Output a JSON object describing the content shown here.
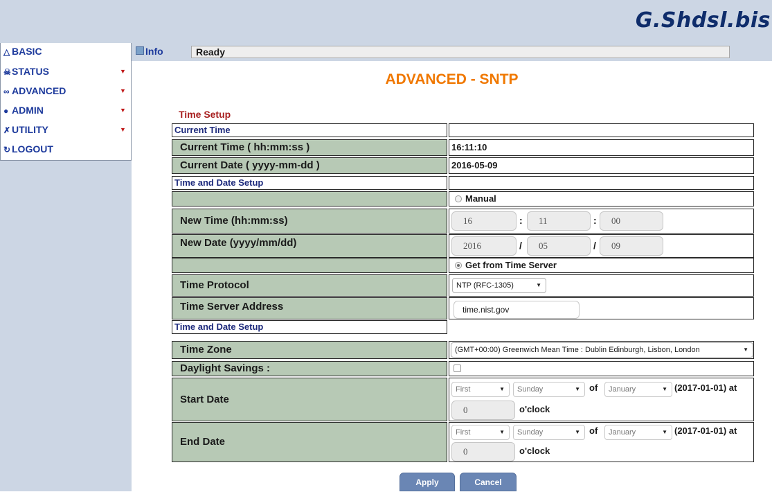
{
  "brand": {
    "name": "G.Shdsl.bis"
  },
  "menu": {
    "items": [
      {
        "label": "BASIC",
        "icon": "basic-icon"
      },
      {
        "label": "STATUS",
        "icon": "status-icon"
      },
      {
        "label": "ADVANCED",
        "icon": "advanced-icon"
      },
      {
        "label": "ADMIN",
        "icon": "admin-icon"
      },
      {
        "label": "UTILITY",
        "icon": "utility-icon"
      },
      {
        "label": "LOGOUT",
        "icon": "logout-icon"
      }
    ]
  },
  "info": {
    "label": "Info",
    "status": "Ready"
  },
  "page": {
    "title": "ADVANCED - SNTP",
    "section": "Time Setup"
  },
  "table": {
    "current_time_header": "Current Time",
    "current_time_label": "Current Time ( hh:mm:ss )",
    "current_time_value": "16:11:10",
    "current_date_label": "Current Date ( yyyy-mm-dd )",
    "current_date_value": "2016-05-09",
    "setup_header": "Time and Date Setup",
    "manual_label": "Manual",
    "new_time_label": "New Time (hh:mm:ss)",
    "new_time": {
      "hh": "16",
      "mm": "11",
      "ss": "00",
      "sep": ":"
    },
    "new_date_label": "New Date (yyyy/mm/dd)",
    "new_date": {
      "yyyy": "2016",
      "mm": "05",
      "dd": "09",
      "sep": "/"
    },
    "get_server_label": "Get from Time Server",
    "protocol_label": "Time Protocol",
    "protocol_value": "NTP (RFC-1305)",
    "server_label": "Time Server Address",
    "server_value": "time.nist.gov",
    "setup_header2": "Time and Date Setup",
    "timezone_label": "Time Zone",
    "timezone_value": "(GMT+00:00) Greenwich Mean Time : Dublin Edinburgh, Lisbon, London",
    "dst_label": "Daylight Savings :",
    "dst_checked": false,
    "start_label": "Start Date",
    "end_label": "End Date",
    "start": {
      "week": "First",
      "day": "Sunday",
      "of": "of",
      "month": "January",
      "date": "(2017-01-01) at",
      "hour": "0",
      "oclock": "o'clock"
    },
    "end": {
      "week": "First",
      "day": "Sunday",
      "of": "of",
      "month": "January",
      "date": "(2017-01-01) at",
      "hour": "0",
      "oclock": "o'clock"
    }
  },
  "buttons": {
    "apply": "Apply",
    "cancel": "Cancel"
  },
  "colors": {
    "accent": "#f07800",
    "label_bg": "#b7c9b5",
    "nav": "#1d3a9c",
    "section": "#a82020",
    "button": "#6a86b4"
  }
}
